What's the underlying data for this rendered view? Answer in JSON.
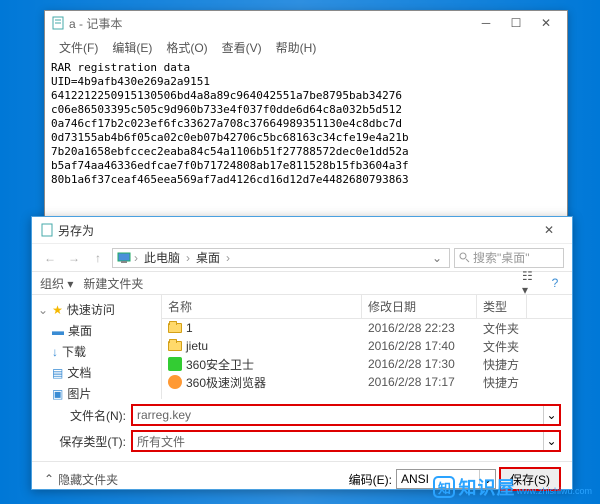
{
  "notepad": {
    "title": "a - 记事本",
    "menu": [
      "文件(F)",
      "编辑(E)",
      "格式(O)",
      "查看(V)",
      "帮助(H)"
    ],
    "content": "RAR registration data\nUID=4b9afb430e269a2a9151\n6412212250915130506bd4a8a89c964042551a7be8795bab34276\nc06e86503395c505c9d960b733e4f037f0dde6d64c8a032b5d512\n0a746cf17b2c023ef6fc33627a708c37664989351130e4c8dbc7d\n0d73155ab4b6f05ca02c0eb07b42706c5bc68163c34cfe19e4a21b\n7b20a1658ebfccec2eaba84c54a1106b51f27788572dec0e1dd52a\nb5af74aa46336edfcae7f0b71724808ab17e811528b15fb3604a3f\n80b1a6f37ceaf465eea569af7ad4126cd16d12d7e4482680793863"
  },
  "saveas": {
    "title": "另存为",
    "nav": {
      "seg1": "此电脑",
      "seg2": "桌面"
    },
    "search_placeholder": "搜索\"桌面\"",
    "toolbar": {
      "organize": "组织 ▾",
      "newfolder": "新建文件夹"
    },
    "sidebar": {
      "header": "快速访问",
      "items": [
        {
          "label": "桌面"
        },
        {
          "label": "下载"
        },
        {
          "label": "文档"
        },
        {
          "label": "图片"
        }
      ]
    },
    "cols": {
      "name": "名称",
      "date": "修改日期",
      "type": "类型"
    },
    "rows": [
      {
        "name": "1",
        "date": "2016/2/28 22:23",
        "type": "文件夹",
        "icon": "folder"
      },
      {
        "name": "jietu",
        "date": "2016/2/28 17:40",
        "type": "文件夹",
        "icon": "folder"
      },
      {
        "name": "360安全卫士",
        "date": "2016/2/28 17:30",
        "type": "快捷方",
        "icon": "app1"
      },
      {
        "name": "360极速浏览器",
        "date": "2016/2/28 17:17",
        "type": "快捷方",
        "icon": "app2"
      }
    ],
    "filename_label": "文件名(N):",
    "filename_value": "rarreg.key",
    "filetype_label": "保存类型(T):",
    "filetype_value": "所有文件",
    "hide_folders": "隐藏文件夹",
    "encoding_label": "编码(E):",
    "encoding_value": "ANSI",
    "save_button": "保存(S)"
  },
  "watermark": {
    "logo": "知",
    "text": "知识屋",
    "url": "www.zhishiwu.com"
  }
}
